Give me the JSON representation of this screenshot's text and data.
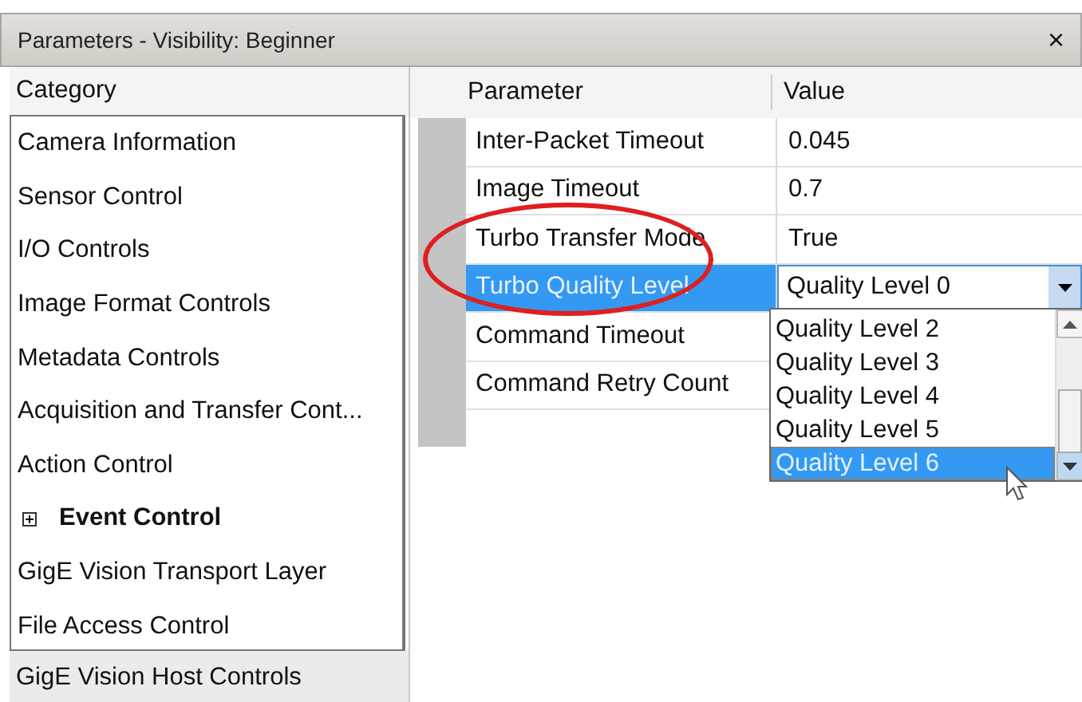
{
  "window": {
    "title": "Parameters - Visibility: Beginner",
    "close": "×"
  },
  "category_panel": {
    "header": "Category",
    "items": [
      {
        "label": "Camera Information",
        "selected": false,
        "kind": "item"
      },
      {
        "label": "Sensor Control",
        "selected": false,
        "kind": "item"
      },
      {
        "label": "I/O Controls",
        "selected": false,
        "kind": "item"
      },
      {
        "label": "Image Format Controls",
        "selected": false,
        "kind": "item"
      },
      {
        "label": "Metadata Controls",
        "selected": false,
        "kind": "item"
      },
      {
        "label": "Acquisition and Transfer Cont...",
        "selected": false,
        "kind": "item"
      },
      {
        "label": "Action Control",
        "selected": false,
        "kind": "item"
      },
      {
        "label": "Event Control",
        "selected": false,
        "kind": "group",
        "expanded": false
      },
      {
        "label": "GigE Vision Transport Layer",
        "selected": false,
        "kind": "item"
      },
      {
        "label": "File Access Control",
        "selected": false,
        "kind": "item"
      },
      {
        "label": "GigE Vision Host Controls",
        "selected": true,
        "kind": "item"
      }
    ]
  },
  "parameter_grid": {
    "columns": [
      "Parameter",
      "Value"
    ],
    "rows": [
      {
        "name": "Inter-Packet Timeout",
        "value": "0.045",
        "selected": false
      },
      {
        "name": "Image Timeout",
        "value": "0.7",
        "selected": false
      },
      {
        "name": "Turbo Transfer Mode",
        "value": "True",
        "selected": false
      },
      {
        "name": "Turbo Quality Level",
        "value": "Quality Level 0",
        "selected": true,
        "kind": "dropdown"
      },
      {
        "name": "Command Timeout",
        "value": "",
        "selected": false
      },
      {
        "name": "Command Retry Count",
        "value": "",
        "selected": false
      }
    ]
  },
  "dropdown_list": {
    "options": [
      {
        "label": "Quality Level 2",
        "selected": false
      },
      {
        "label": "Quality Level 3",
        "selected": false
      },
      {
        "label": "Quality Level 4",
        "selected": false
      },
      {
        "label": "Quality Level 5",
        "selected": false
      },
      {
        "label": "Quality Level 6",
        "selected": true
      }
    ]
  }
}
